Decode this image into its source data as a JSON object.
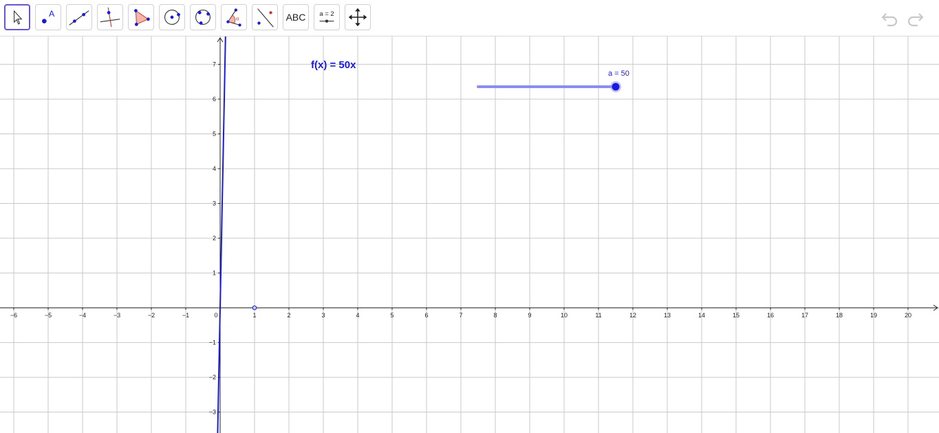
{
  "toolbar": {
    "tools": [
      {
        "name": "move-tool",
        "icon": "arrow-cursor-icon"
      },
      {
        "name": "point-tool",
        "icon": "point-icon",
        "label": "A"
      },
      {
        "name": "line-tool",
        "icon": "line-through-points-icon"
      },
      {
        "name": "perpendicular-line-tool",
        "icon": "perpendicular-line-icon"
      },
      {
        "name": "polygon-tool",
        "icon": "polygon-icon"
      },
      {
        "name": "circle-center-point-tool",
        "icon": "circle-center-icon"
      },
      {
        "name": "circle-three-points-tool",
        "icon": "circle-three-points-icon"
      },
      {
        "name": "angle-tool",
        "icon": "angle-icon",
        "label": "α"
      },
      {
        "name": "reflect-tool",
        "icon": "reflect-about-line-icon"
      },
      {
        "name": "text-tool",
        "icon": "text-icon",
        "label": "ABC"
      },
      {
        "name": "slider-tool",
        "icon": "slider-icon",
        "label": "a = 2"
      },
      {
        "name": "move-graphics-view-tool",
        "icon": "move-arrows-icon"
      }
    ],
    "undo_icon": "undo-icon",
    "redo_icon": "redo-icon",
    "active_color": "#6557d2"
  },
  "graphics": {
    "function_label": "f(x) = 50x",
    "function_slope": 50,
    "function_color": "#1a1adc",
    "x_range": [
      -6.4,
      20.9
    ],
    "y_range": [
      -3.6,
      7.8
    ],
    "x_ticks": [
      "−6",
      "−5",
      "−4",
      "−3",
      "−2",
      "−1",
      "0",
      "1",
      "2",
      "3",
      "4",
      "5",
      "6",
      "7",
      "8",
      "9",
      "10",
      "11",
      "12",
      "13",
      "14",
      "15",
      "16",
      "17",
      "18",
      "19",
      "20"
    ],
    "y_ticks": [
      "−3",
      "−2",
      "−1",
      "1",
      "2",
      "3",
      "4",
      "5",
      "6",
      "7"
    ],
    "point": {
      "x": 1,
      "y": 0
    },
    "grid": true
  },
  "slider": {
    "label": "a = 50",
    "value": 50,
    "min": -50,
    "max": 50,
    "color": "#1a1adc"
  }
}
